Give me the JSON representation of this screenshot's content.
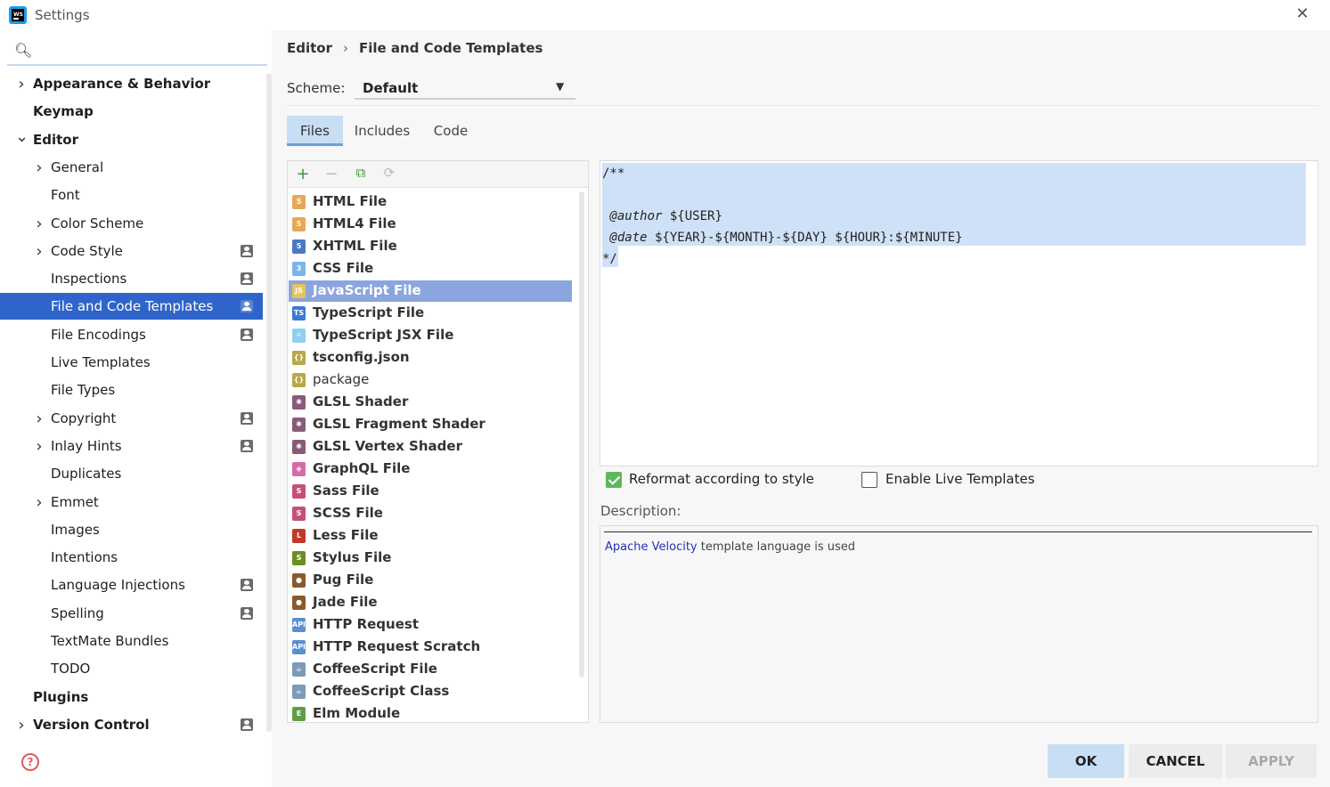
{
  "window": {
    "title": "Settings"
  },
  "breadcrumb": {
    "parent": "Editor",
    "separator": "›",
    "current": "File and Code Templates"
  },
  "scheme": {
    "label": "Scheme:",
    "value": "Default"
  },
  "tabs": [
    {
      "label": "Files",
      "active": true
    },
    {
      "label": "Includes",
      "active": false
    },
    {
      "label": "Code",
      "active": false
    }
  ],
  "sidebar": {
    "items": [
      {
        "label": "Appearance & Behavior",
        "bold": true,
        "chevron": "right",
        "indent": 0,
        "badge": false
      },
      {
        "label": "Keymap",
        "bold": true,
        "chevron": "",
        "indent": 0,
        "badge": false
      },
      {
        "label": "Editor",
        "bold": true,
        "chevron": "down",
        "indent": 0,
        "badge": false
      },
      {
        "label": "General",
        "bold": false,
        "chevron": "right",
        "indent": 1,
        "badge": false
      },
      {
        "label": "Font",
        "bold": false,
        "chevron": "",
        "indent": 1,
        "badge": false
      },
      {
        "label": "Color Scheme",
        "bold": false,
        "chevron": "right",
        "indent": 1,
        "badge": false
      },
      {
        "label": "Code Style",
        "bold": false,
        "chevron": "right",
        "indent": 1,
        "badge": true
      },
      {
        "label": "Inspections",
        "bold": false,
        "chevron": "",
        "indent": 1,
        "badge": true
      },
      {
        "label": "File and Code Templates",
        "bold": false,
        "chevron": "",
        "indent": 1,
        "badge": true,
        "selected": true
      },
      {
        "label": "File Encodings",
        "bold": false,
        "chevron": "",
        "indent": 1,
        "badge": true
      },
      {
        "label": "Live Templates",
        "bold": false,
        "chevron": "",
        "indent": 1,
        "badge": false
      },
      {
        "label": "File Types",
        "bold": false,
        "chevron": "",
        "indent": 1,
        "badge": false
      },
      {
        "label": "Copyright",
        "bold": false,
        "chevron": "right",
        "indent": 1,
        "badge": true
      },
      {
        "label": "Inlay Hints",
        "bold": false,
        "chevron": "right",
        "indent": 1,
        "badge": true
      },
      {
        "label": "Duplicates",
        "bold": false,
        "chevron": "",
        "indent": 1,
        "badge": false
      },
      {
        "label": "Emmet",
        "bold": false,
        "chevron": "right",
        "indent": 1,
        "badge": false
      },
      {
        "label": "Images",
        "bold": false,
        "chevron": "",
        "indent": 1,
        "badge": false
      },
      {
        "label": "Intentions",
        "bold": false,
        "chevron": "",
        "indent": 1,
        "badge": false
      },
      {
        "label": "Language Injections",
        "bold": false,
        "chevron": "",
        "indent": 1,
        "badge": true
      },
      {
        "label": "Spelling",
        "bold": false,
        "chevron": "",
        "indent": 1,
        "badge": true
      },
      {
        "label": "TextMate Bundles",
        "bold": false,
        "chevron": "",
        "indent": 1,
        "badge": false
      },
      {
        "label": "TODO",
        "bold": false,
        "chevron": "",
        "indent": 1,
        "badge": false
      },
      {
        "label": "Plugins",
        "bold": true,
        "chevron": "",
        "indent": 0,
        "badge": false
      },
      {
        "label": "Version Control",
        "bold": true,
        "chevron": "right",
        "indent": 0,
        "badge": true
      }
    ]
  },
  "files": [
    {
      "label": "HTML File",
      "icon": "html-icon",
      "color": "#e8a857",
      "glyph": "5"
    },
    {
      "label": "HTML4 File",
      "icon": "html-icon",
      "color": "#e8a857",
      "glyph": "5"
    },
    {
      "label": "XHTML File",
      "icon": "xhtml-icon",
      "color": "#4a78c4",
      "glyph": "5"
    },
    {
      "label": "CSS File",
      "icon": "css-icon",
      "color": "#7bb5e8",
      "glyph": "3"
    },
    {
      "label": "JavaScript File",
      "icon": "javascript-icon",
      "color": "#e8c35a",
      "glyph": "JS",
      "selected": true
    },
    {
      "label": "TypeScript File",
      "icon": "typescript-icon",
      "color": "#3a7bd5",
      "glyph": "TS"
    },
    {
      "label": "TypeScript JSX File",
      "icon": "react-icon",
      "color": "#8ed0f0",
      "glyph": "⚛"
    },
    {
      "label": "tsconfig.json",
      "icon": "json-icon",
      "color": "#b9a84a",
      "glyph": "{}"
    },
    {
      "label": "package",
      "icon": "json-icon",
      "color": "#b9a84a",
      "glyph": "{}",
      "plain": true
    },
    {
      "label": "GLSL Shader",
      "icon": "glsl-icon",
      "color": "#8a5a7a",
      "glyph": "✺"
    },
    {
      "label": "GLSL Fragment Shader",
      "icon": "glsl-icon",
      "color": "#8a5a7a",
      "glyph": "✺"
    },
    {
      "label": "GLSL Vertex Shader",
      "icon": "glsl-icon",
      "color": "#8a5a7a",
      "glyph": "✺"
    },
    {
      "label": "GraphQL File",
      "icon": "graphql-icon",
      "color": "#d86aa8",
      "glyph": "◈"
    },
    {
      "label": "Sass File",
      "icon": "sass-icon",
      "color": "#c64f7a",
      "glyph": "S"
    },
    {
      "label": "SCSS File",
      "icon": "scss-icon",
      "color": "#c64f7a",
      "glyph": "S"
    },
    {
      "label": "Less File",
      "icon": "less-icon",
      "color": "#c0392b",
      "glyph": "L"
    },
    {
      "label": "Stylus File",
      "icon": "stylus-icon",
      "color": "#6b8e23",
      "glyph": "S"
    },
    {
      "label": "Pug File",
      "icon": "pug-icon",
      "color": "#8b5a2b",
      "glyph": "●"
    },
    {
      "label": "Jade File",
      "icon": "jade-icon",
      "color": "#8b5a2b",
      "glyph": "●"
    },
    {
      "label": "HTTP Request",
      "icon": "http-icon",
      "color": "#5a8fd0",
      "glyph": "API"
    },
    {
      "label": "HTTP Request Scratch",
      "icon": "http-icon",
      "color": "#5a8fd0",
      "glyph": "API"
    },
    {
      "label": "CoffeeScript File",
      "icon": "coffeescript-icon",
      "color": "#7b9ab5",
      "glyph": "☕"
    },
    {
      "label": "CoffeeScript Class",
      "icon": "coffeescript-icon",
      "color": "#7b9ab5",
      "glyph": "☕"
    },
    {
      "label": "Elm Module",
      "icon": "elm-icon",
      "color": "#5f9e44",
      "glyph": "E"
    }
  ],
  "editor": {
    "lines": [
      {
        "tag": "",
        "text": "/**"
      },
      {
        "tag": "",
        "text": ""
      },
      {
        "tag": " @author",
        "text": " ${USER}"
      },
      {
        "tag": " @date",
        "text": " ${YEAR}-${MONTH}-${DAY} ${HOUR}:${MINUTE}"
      },
      {
        "tag": "",
        "text": "*/"
      }
    ]
  },
  "options": {
    "reformat": {
      "label": "Reformat according to style",
      "checked": true
    },
    "live_templates": {
      "label": "Enable Live Templates",
      "checked": false
    }
  },
  "description": {
    "label": "Description:",
    "link": "Apache Velocity",
    "text": " template language is used"
  },
  "buttons": {
    "ok": "OK",
    "cancel": "CANCEL",
    "apply": "APPLY"
  },
  "help_glyph": "?",
  "colors": {
    "accent": "#2f65ca",
    "selection": "#8ba5de",
    "tab_active": "#c8def5",
    "code_highlight": "#cfe1f7"
  }
}
